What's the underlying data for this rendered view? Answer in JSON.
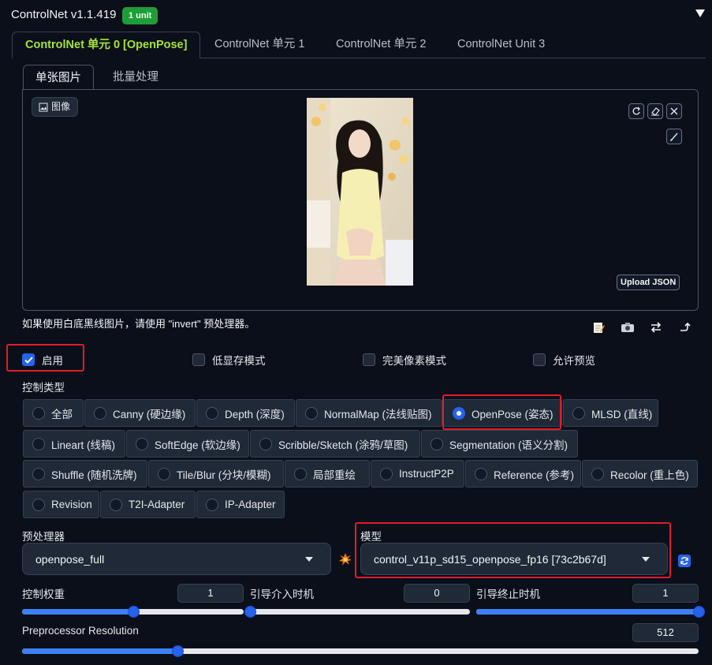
{
  "header": {
    "title": "ControlNet v1.1.419",
    "badge": "1 unit"
  },
  "unit_tabs": [
    "ControlNet 单元 0 [OpenPose]",
    "ControlNet 单元 1",
    "ControlNet 单元 2",
    "ControlNet Unit 3"
  ],
  "image_tabs": [
    "单张图片",
    "批量处理"
  ],
  "image_panel": {
    "label": "图像",
    "upload_json": "Upload JSON"
  },
  "hint": "如果使用白底黑线图片，请使用 \"invert\" 预处理器。",
  "options": {
    "enable": "启用",
    "low_vram": "低显存模式",
    "pixel_perfect": "完美像素模式",
    "allow_preview": "允许预览",
    "enable_checked": true
  },
  "control_type": {
    "label": "控制类型",
    "selected": "OpenPose (姿态)",
    "items": [
      "全部",
      "Canny (硬边缘)",
      "Depth (深度)",
      "NormalMap (法线贴图)",
      "OpenPose (姿态)",
      "MLSD (直线)",
      "Lineart (线稿)",
      "SoftEdge (软边缘)",
      "Scribble/Sketch (涂鸦/草图)",
      "Segmentation (语义分割)",
      "Shuffle (随机洗牌)",
      "Tile/Blur (分块/模糊)",
      "局部重绘",
      "InstructP2P",
      "Reference (参考)",
      "Recolor (重上色)",
      "Revision",
      "T2I-Adapter",
      "IP-Adapter"
    ]
  },
  "preprocessor": {
    "label": "预处理器",
    "value": "openpose_full"
  },
  "model": {
    "label": "模型",
    "value": "control_v11p_sd15_openpose_fp16 [73c2b67d]"
  },
  "control_weight": {
    "label": "控制权重",
    "value": "1",
    "level": 0.5
  },
  "start_step": {
    "label": "引导介入时机",
    "value": "0",
    "level": 0.0
  },
  "end_step": {
    "label": "引导终止时机",
    "value": "1",
    "level": 1.0
  },
  "resolution": {
    "label": "Preprocessor Resolution",
    "value": "512",
    "level": 0.23
  },
  "colors": {
    "accent": "#2563eb",
    "active_tab": "#a3e635",
    "highlight": "#e11d2a",
    "badge": "#1f9d3a"
  }
}
